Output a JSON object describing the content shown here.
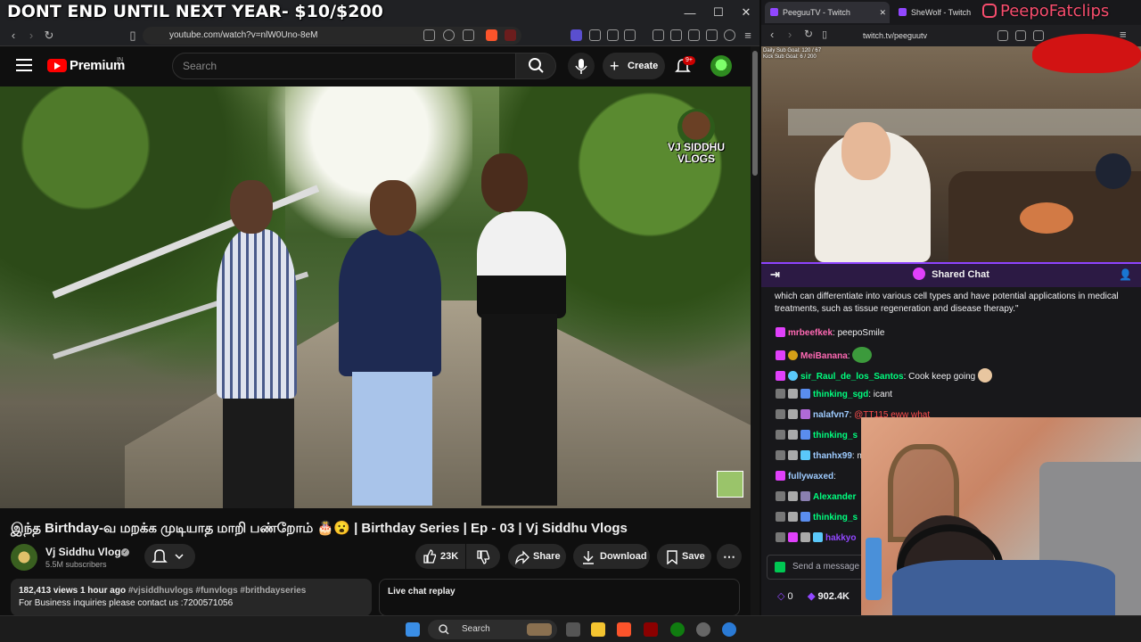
{
  "overlay": {
    "banner": "DONT END UNTIL NEXT YEAR- $10/$200",
    "watermark": "PeepoFatclips"
  },
  "left_browser": {
    "url": "youtube.com/watch?v=nlW0Uno-8eM"
  },
  "youtube": {
    "logo_text": "Premium",
    "logo_region": "IN",
    "search_placeholder": "Search",
    "create_label": "Create",
    "notifications_badge": "9+",
    "video_overlay_channel": "VJ SIDDHU VLOGS",
    "video_title": "இந்த Birthday-வ மறக்க முடியாத மாறி பண்றோம் 🎂😮 | Birthday Series | Ep - 03 | Vj Siddhu Vlogs",
    "channel_name": "Vj Siddhu Vlogs",
    "subscribers": "5.5M subscribers",
    "likes": "23K",
    "share_label": "Share",
    "download_label": "Download",
    "save_label": "Save",
    "description": {
      "meta": "182,413 views  1 hour ago",
      "tags": "#vjsiddhuvlogs #funvlogs #brithdayseries",
      "line2": "For Business inquiries please contact us :7200571056"
    },
    "live_chat_label": "Live chat replay"
  },
  "right_browser": {
    "tabs": [
      {
        "label": "PeeguuTV - Twitch"
      },
      {
        "label": "SheWolf - Twitch"
      }
    ],
    "url": "twitch.tv/peeguutv",
    "stream_overlay": [
      "Daily Sub Goal: 120 / 67",
      "Kick Sub Goal: 6 / 200"
    ],
    "shared_chat_label": "Shared Chat",
    "chat_intro": "which can differentiate into various cell types and have potential applications in medical treatments, such as tissue regeneration and disease therapy.\"",
    "chat": [
      {
        "user": "mrbeefkek",
        "color": "#ff69b4",
        "text": "peepoSmile"
      },
      {
        "user": "MeiBanana",
        "color": "#ff69b4",
        "text": ""
      },
      {
        "user": "sir_Raul_de_los_Santos",
        "color": "#00ff7f",
        "text": "Cook keep going"
      },
      {
        "user": "thinking_sgd",
        "color": "#00ff7f",
        "text": "icant"
      },
      {
        "user": "nalafvn7",
        "color": "#9ecbff",
        "text": "@TT115 eww what",
        "mention": "@TT115"
      },
      {
        "user": "thinking_s",
        "color": "#00ff7f",
        "text": ""
      },
      {
        "user": "thanhx99",
        "color": "#9ecbff",
        "text": "me"
      },
      {
        "user": "fullywaxed",
        "color": "#9ecbff",
        "text": ""
      },
      {
        "user": "Alexander",
        "color": "#00ff7f",
        "text": ""
      },
      {
        "user": "thinking_s",
        "color": "#00ff7f",
        "text": ""
      },
      {
        "user": "hakkyo",
        "color": "#9147ff",
        "text": ""
      }
    ],
    "send_placeholder": "Send a message",
    "points": "0",
    "viewers": "902.4K"
  },
  "taskbar": {
    "search_label": "Search"
  }
}
